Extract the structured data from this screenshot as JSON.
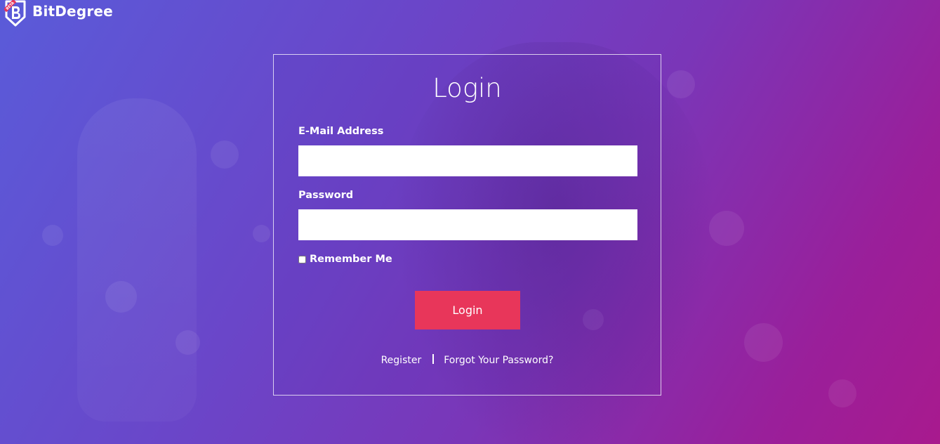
{
  "brand": {
    "name": "BitDegree",
    "badge": "BETA",
    "logo_icon": "shield-b-icon",
    "badge_color": "#e8365a"
  },
  "login_form": {
    "title": "Login",
    "email_label": "E-Mail Address",
    "email_value": "",
    "password_label": "Password",
    "password_value": "",
    "remember_label": "Remember Me",
    "remember_checked": false,
    "submit_label": "Login",
    "submit_color": "#e8365a"
  },
  "links": {
    "register": "Register",
    "forgot_password": "Forgot Your Password?"
  },
  "colors": {
    "background_start": "#5a5bd9",
    "background_end": "#a81a8e"
  }
}
